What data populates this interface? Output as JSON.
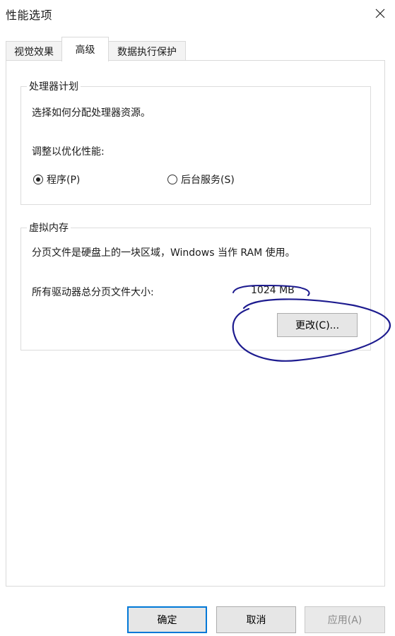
{
  "window": {
    "title": "性能选项",
    "close_icon": "close-icon"
  },
  "tabs": [
    {
      "label": "视觉效果"
    },
    {
      "label": "高级"
    },
    {
      "label": "数据执行保护"
    }
  ],
  "processor": {
    "title": "处理器计划",
    "description": "选择如何分配处理器资源。",
    "adjust_label": "调整以优化性能:",
    "options": [
      {
        "label": "程序(P)",
        "checked": true
      },
      {
        "label": "后台服务(S)",
        "checked": false
      }
    ]
  },
  "virtual_memory": {
    "title": "虚拟内存",
    "description": "分页文件是硬盘上的一块区域，Windows 当作 RAM 使用。",
    "total_label": "所有驱动器总分页文件大小:",
    "total_value": "1024 MB",
    "change_button": "更改(C)..."
  },
  "footer": {
    "ok": "确定",
    "cancel": "取消",
    "apply": "应用(A)"
  },
  "annotation_color": "#1d1b8f"
}
